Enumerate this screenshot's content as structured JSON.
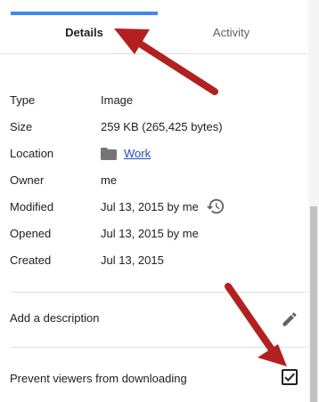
{
  "tabs": {
    "details_label": "Details",
    "activity_label": "Activity",
    "active": "Details"
  },
  "colors": {
    "tab_indicator": "#4285f4",
    "link": "#1a4fc4",
    "arrow": "#b22020",
    "divider": "#e0e0e0"
  },
  "details": {
    "type_label": "Type",
    "type_value": "Image",
    "size_label": "Size",
    "size_value": "259 KB (265,425 bytes)",
    "location_label": "Location",
    "location_value": "Work",
    "owner_label": "Owner",
    "owner_value": "me",
    "modified_label": "Modified",
    "modified_value": "Jul 13, 2015 by me",
    "opened_label": "Opened",
    "opened_value": "Jul 13, 2015 by me",
    "created_label": "Created",
    "created_value": "Jul 13, 2015"
  },
  "description": {
    "label": "Add a description"
  },
  "download": {
    "label": "Prevent viewers from downloading",
    "checked": true
  },
  "icons": {
    "location": "folder-icon",
    "modified": "history-icon",
    "description": "pencil-icon",
    "download": "checkbox-checked-icon"
  }
}
